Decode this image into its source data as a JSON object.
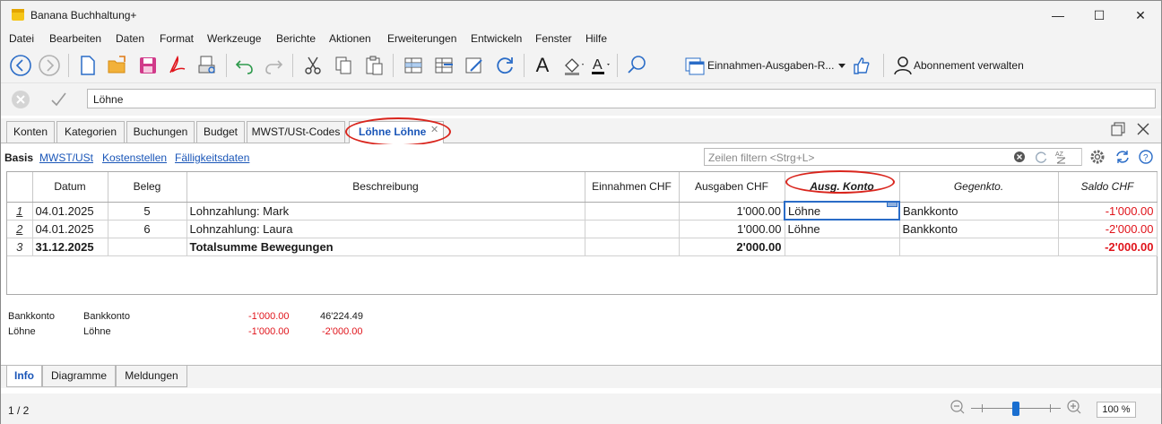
{
  "window": {
    "title": "Banana Buchhaltung+",
    "minimize": "—",
    "maximize": "☐",
    "close": "✕"
  },
  "menu": [
    "Datei",
    "Bearbeiten",
    "Daten",
    "Format",
    "Werkzeuge",
    "Berichte",
    "Aktionen",
    "Erweiterungen",
    "Entwickeln",
    "Fenster",
    "Hilfe"
  ],
  "toolbar": {
    "layout_combo": "Einnahmen-Ausgaben-R...",
    "subscription": "Abonnement verwalten",
    "font_glyph": "A"
  },
  "editbar": {
    "value": "Löhne"
  },
  "tabs": [
    "Konten",
    "Kategorien",
    "Buchungen",
    "Budget",
    "MWST/USt-Codes",
    "Löhne Löhne"
  ],
  "views": {
    "basis": "Basis",
    "links": [
      "MWST/USt",
      "Kostenstellen",
      "Fälligkeitsdaten"
    ],
    "filter_placeholder": "Zeilen filtern <Strg+L>"
  },
  "table": {
    "columns": [
      "",
      "Datum",
      "Beleg",
      "Beschreibung",
      "Einnahmen CHF",
      "Ausgaben CHF",
      "Ausg. Konto",
      "Gegenkto.",
      "Saldo CHF"
    ],
    "rows": [
      {
        "nr": "1",
        "datum": "04.01.2025",
        "beleg": "5",
        "beschreibung": "Lohnzahlung: Mark",
        "einnahmen": "",
        "ausgaben": "1'000.00",
        "konto": "Löhne",
        "gegenkto": "Bankkonto",
        "saldo": "-1'000.00"
      },
      {
        "nr": "2",
        "datum": "04.01.2025",
        "beleg": "6",
        "beschreibung": "Lohnzahlung: Laura",
        "einnahmen": "",
        "ausgaben": "1'000.00",
        "konto": "Löhne",
        "gegenkto": "Bankkonto",
        "saldo": "-2'000.00"
      },
      {
        "nr": "3",
        "datum": "31.12.2025",
        "beleg": "",
        "beschreibung": "Totalsumme Bewegungen",
        "einnahmen": "",
        "ausgaben": "2'000.00",
        "konto": "",
        "gegenkto": "",
        "saldo": "-2'000.00"
      }
    ]
  },
  "info_panel": [
    {
      "account": "Bankkonto",
      "name": "Bankkonto",
      "amount": "-1'000.00",
      "balance": "46'224.49"
    },
    {
      "account": "Löhne",
      "name": "Löhne",
      "amount": "-1'000.00",
      "balance": "-2'000.00"
    }
  ],
  "bottom_tabs": [
    "Info",
    "Diagramme",
    "Meldungen"
  ],
  "status": {
    "page": "1 / 2",
    "zoom": "100 %"
  },
  "colors": {
    "accent": "#1a56b8",
    "negative": "#e0141b",
    "highlight": "#d9251d"
  }
}
